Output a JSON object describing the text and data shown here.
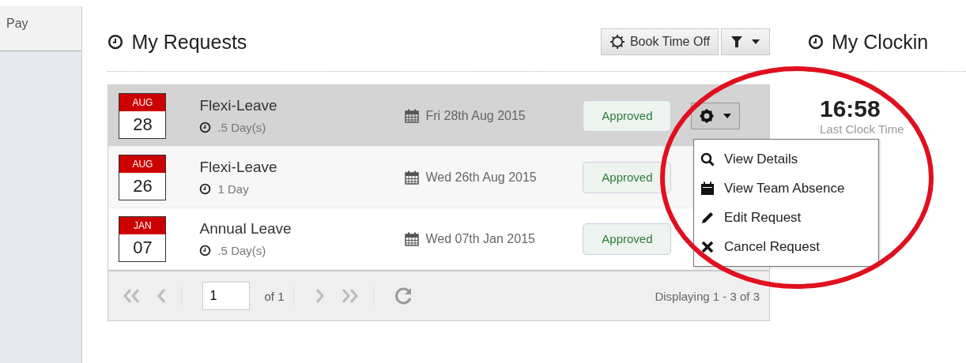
{
  "sidebar": {
    "items": [
      {
        "label": "Pay",
        "selected": false
      }
    ]
  },
  "requests": {
    "title": "My Requests",
    "book_button": "Book Time Off",
    "rows": [
      {
        "month": "AUG",
        "day": "28",
        "type": "Flexi-Leave",
        "duration": ".5 Day(s)",
        "date": "Fri 28th Aug 2015",
        "status": "Approved",
        "selected": true
      },
      {
        "month": "AUG",
        "day": "26",
        "type": "Flexi-Leave",
        "duration": "1 Day",
        "date": "Wed 26th Aug 2015",
        "status": "Approved",
        "selected": false
      },
      {
        "month": "JAN",
        "day": "07",
        "type": "Annual Leave",
        "duration": ".5 Day(s)",
        "date": "Wed 07th Jan 2015",
        "status": "Approved",
        "selected": false
      }
    ],
    "menu": [
      {
        "kind": "search",
        "label": "View Details"
      },
      {
        "kind": "calendar",
        "label": "View Team Absence"
      },
      {
        "kind": "pencil",
        "label": "Edit Request"
      },
      {
        "kind": "cross",
        "label": "Cancel Request"
      }
    ],
    "pager": {
      "page": "1",
      "of": "of 1",
      "display": "Displaying 1 - 3 of 3"
    }
  },
  "clocking": {
    "title": "My Clockin",
    "time": "16:58",
    "caption": "Last Clock Time"
  }
}
